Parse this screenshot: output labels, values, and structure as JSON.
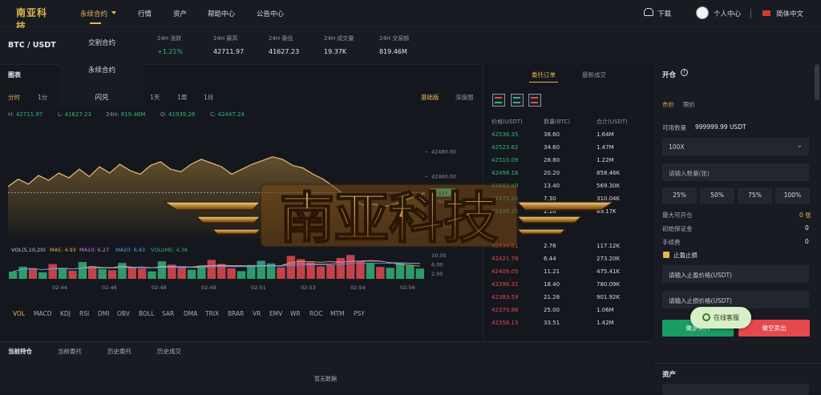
{
  "nav": {
    "logo": "南亚科技",
    "items": [
      "永续合约",
      "行情",
      "资产",
      "帮助中心",
      "公告中心"
    ],
    "download": "下载",
    "user_center": "个人中心",
    "language": "简体中文"
  },
  "dropdown": [
    "交割合约",
    "永续合约",
    "闪兑"
  ],
  "ticker": {
    "pair": "BTC / USDT",
    "labels": [
      "24H 涨跌",
      "24H 最高",
      "24H 最低",
      "24H 成交量",
      "24H 交易额"
    ],
    "values": [
      "+1.21%",
      "42711.97",
      "41627.23",
      "19.37K",
      "819.46M"
    ]
  },
  "chart": {
    "title": "图表",
    "timeframes": [
      "分时",
      "1分",
      "1天",
      "1周",
      "1月"
    ],
    "modes": [
      "基础版",
      "深度图"
    ],
    "ohlc": [
      {
        "k": "H:",
        "v": "42711.97"
      },
      {
        "k": "L:",
        "v": "41627.23"
      },
      {
        "k": "24H:",
        "v": "819.46M"
      },
      {
        "k": "O:",
        "v": "41939.26"
      },
      {
        "k": "C:",
        "v": "42447.24"
      }
    ],
    "price_ticks": [
      "42480.00",
      "42460.00",
      "42440.00",
      "42420.00"
    ],
    "current_price": "42447.24",
    "volume_ticks": [
      "10.00",
      "6.00",
      "2.00"
    ],
    "time_ticks": [
      "02:44",
      "02:46",
      "02:48",
      "02:49",
      "02:51",
      "02:53",
      "02:54",
      "02:56"
    ],
    "indicators": [
      {
        "label": "VOL(5,10,20)",
        "color": "#c8ccd4"
      },
      {
        "label": "MA5: 4.93",
        "color": "#e8b651"
      },
      {
        "label": "MA10: 6.27",
        "color": "#d080e0"
      },
      {
        "label": "MA20: 6.43",
        "color": "#4aa8e8"
      },
      {
        "label": "VOLUME: 4.38",
        "color": "#32b57a"
      }
    ],
    "indicator_tabs": [
      "VOL",
      "MACD",
      "KDJ",
      "RSI",
      "DMI",
      "OBV",
      "BOLL",
      "SAR",
      "DMA",
      "TRIX",
      "BRAR",
      "VR",
      "EMV",
      "WR",
      "ROC",
      "MTM",
      "PSY"
    ]
  },
  "chart_data": {
    "type": "line",
    "x": [
      "02:44",
      "02:46",
      "02:48",
      "02:49",
      "02:51",
      "02:53",
      "02:54",
      "02:56"
    ],
    "ylim": [
      42410,
      42490
    ],
    "price_series": [
      42452,
      42458,
      42454,
      42461,
      42457,
      42463,
      42459,
      42466,
      42460,
      42468,
      42463,
      42470,
      42465,
      42462,
      42469,
      42472,
      42466,
      42464,
      42470,
      42474,
      42471,
      42468,
      42462,
      42466,
      42470,
      42473,
      42476,
      42474,
      42469,
      42467,
      42462,
      42458,
      42452,
      42446,
      42441,
      42437,
      42438,
      42436,
      42438,
      42441,
      42444,
      42447
    ],
    "volume_series": [
      3.1,
      5.2,
      4.6,
      2.8,
      6.3,
      4.1,
      3.5,
      7.2,
      5.4,
      4.2,
      3.7,
      6.8,
      5.1,
      4.4,
      3.2,
      7.5,
      6.1,
      4.8,
      3.9,
      5.6,
      8.1,
      6.4,
      4.5,
      3.3,
      5.9,
      7.7,
      6.6,
      4.9,
      9.8,
      8.4,
      7.1,
      5.3,
      6.2,
      8.9,
      10.2,
      7.4,
      6.8,
      5.1,
      4.7,
      6.9,
      5.8,
      4.4
    ]
  },
  "orderbook": {
    "tabs": [
      "委托订单",
      "最新成交"
    ],
    "headers": [
      "价格(USDT)",
      "数量(BTC)",
      "合计(USDT)"
    ],
    "asks": [
      [
        "42536.35",
        "38.60",
        "1.64M"
      ],
      [
        "42523.62",
        "34.60",
        "1.47M"
      ],
      [
        "42510.09",
        "28.80",
        "1.22M"
      ],
      [
        "42498.16",
        "20.20",
        "858.46K"
      ],
      [
        "42483.48",
        "13.40",
        "569.30K"
      ],
      [
        "42471.24",
        "7.30",
        "310.04K"
      ],
      [
        "42459.35",
        "2.10",
        "89.17K"
      ]
    ],
    "bids": [
      [
        "42434.51",
        "2.76",
        "117.12K"
      ],
      [
        "42421.78",
        "6.44",
        "273.20K"
      ],
      [
        "42409.05",
        "11.21",
        "475.41K"
      ],
      [
        "42396.32",
        "18.40",
        "780.09K"
      ],
      [
        "42383.59",
        "21.28",
        "901.92K"
      ],
      [
        "42370.86",
        "25.00",
        "1.06M"
      ],
      [
        "42358.13",
        "33.51",
        "1.42M"
      ]
    ]
  },
  "trade": {
    "title": "开仓",
    "order_types": [
      "市价",
      "限价"
    ],
    "available_label": "可用数量",
    "available_value": "999999.99 USDT",
    "leverage": "100X",
    "qty_placeholder": "请输入数量(张)",
    "percents": [
      "25%",
      "50%",
      "75%",
      "100%"
    ],
    "max_open_label": "最大可开仓",
    "max_open_value": "0 张",
    "margin_label": "初始保证金",
    "margin_value": "0",
    "fee_label": "手续费",
    "fee_value": "0",
    "stop_label": "止盈止损",
    "tp_placeholder": "请输入止盈价格(USDT)",
    "sl_placeholder": "请输入止损价格(USDT)",
    "buy_label": "做多买入",
    "sell_label": "做空卖出",
    "customer_service": "在线客服"
  },
  "bottom": {
    "tabs": [
      "当前持仓",
      "当前委托",
      "历史委托",
      "历史成交"
    ],
    "empty": "暂无数据"
  },
  "assets": {
    "title": "资产"
  },
  "watermark": "南亚科技"
}
